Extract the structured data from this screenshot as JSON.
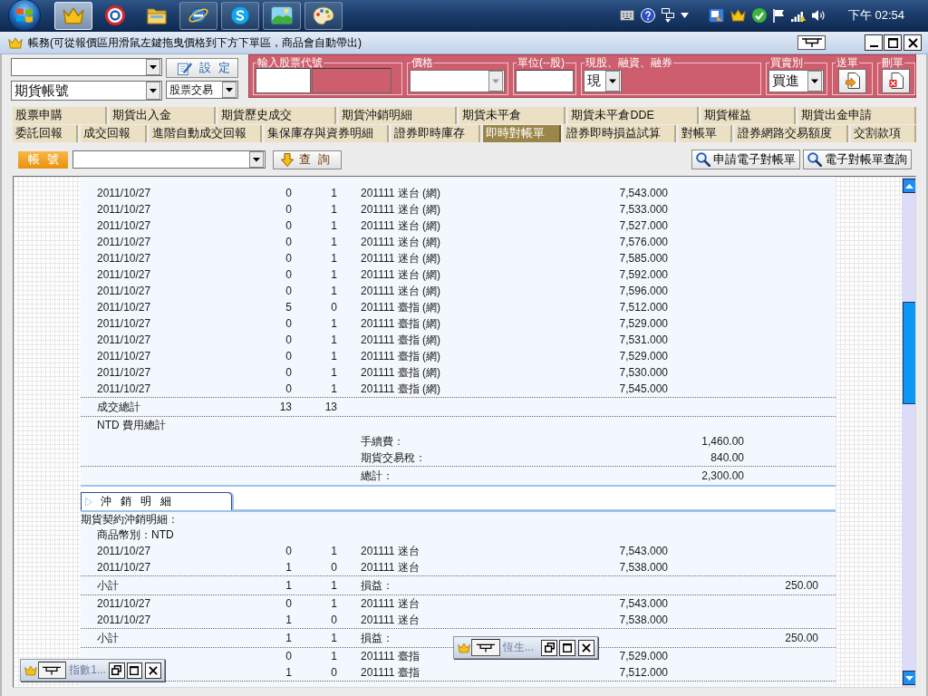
{
  "taskbar": {
    "buttons": [
      {
        "running": true,
        "selected": true
      },
      {
        "running": false,
        "selected": false
      },
      {
        "running": false,
        "selected": false
      },
      {
        "running": true,
        "selected": false
      },
      {
        "running": true,
        "selected": false
      },
      {
        "running": true,
        "selected": false
      },
      {
        "running": true,
        "selected": false
      }
    ],
    "clock": "下午 02:54"
  },
  "window": {
    "title": "帳務(可從報價區用滑鼠左鍵拖曳價格到下方下單區，商品會自動帶出)"
  },
  "order_form": {
    "settings_button": "設定",
    "account_select": {
      "value": "期貨帳號"
    },
    "trade_type_select": {
      "value": "股票交易"
    }
  },
  "order_panel": {
    "stock_code": {
      "label": "輸入股票代號"
    },
    "price": {
      "label": "價格",
      "disabled": true
    },
    "unit": {
      "label": "單位(--股)"
    },
    "position_type": {
      "label": "現股、融資、融券",
      "value": "現"
    },
    "side": {
      "label": "買賣別",
      "value": "買進"
    },
    "send": {
      "label": "送單"
    },
    "delete": {
      "label": "刪單"
    }
  },
  "tab_rows": [
    [
      {
        "label": "股票申購",
        "selected": false
      },
      {
        "label": "期貨出入金",
        "selected": false
      },
      {
        "label": "期貨歷史成交",
        "selected": false
      },
      {
        "label": "期貨沖銷明細",
        "selected": false
      },
      {
        "label": "期貨未平倉",
        "selected": false
      },
      {
        "label": "期貨未平倉DDE",
        "selected": false
      },
      {
        "label": "期貨權益",
        "selected": false
      },
      {
        "label": "期貨出金申請",
        "selected": false
      }
    ],
    [
      {
        "label": "委託回報",
        "selected": false
      },
      {
        "label": "成交回報",
        "selected": false
      },
      {
        "label": "進階自動成交回報",
        "selected": false
      },
      {
        "label": "集保庫存與資券明細",
        "selected": false
      },
      {
        "label": "證券即時庫存",
        "selected": false
      },
      {
        "label": "即時對帳單",
        "selected": true
      },
      {
        "label": "證券即時損益試算",
        "selected": false
      },
      {
        "label": "對帳單",
        "selected": false
      },
      {
        "label": "證券網路交易額度",
        "selected": false
      },
      {
        "label": "交割款項",
        "selected": false
      }
    ]
  ],
  "toolbar": {
    "account_label": "帳號",
    "query_button": "查詢",
    "actions": [
      "申請電子對帳單",
      "電子對帳單查詢"
    ]
  },
  "statement": {
    "trades": [
      {
        "date": "2011/10/27",
        "column_2": "0",
        "column_3": "1",
        "contract": "201111 迷台 (網)",
        "price": "7,543.000"
      },
      {
        "date": "2011/10/27",
        "column_2": "0",
        "column_3": "1",
        "contract": "201111 迷台 (網)",
        "price": "7,533.000"
      },
      {
        "date": "2011/10/27",
        "column_2": "0",
        "column_3": "1",
        "contract": "201111 迷台 (網)",
        "price": "7,527.000"
      },
      {
        "date": "2011/10/27",
        "column_2": "0",
        "column_3": "1",
        "contract": "201111 迷台 (網)",
        "price": "7,576.000"
      },
      {
        "date": "2011/10/27",
        "column_2": "0",
        "column_3": "1",
        "contract": "201111 迷台 (網)",
        "price": "7,585.000"
      },
      {
        "date": "2011/10/27",
        "column_2": "0",
        "column_3": "1",
        "contract": "201111 迷台 (網)",
        "price": "7,592.000"
      },
      {
        "date": "2011/10/27",
        "column_2": "0",
        "column_3": "1",
        "contract": "201111 迷台 (網)",
        "price": "7,596.000"
      },
      {
        "date": "2011/10/27",
        "column_2": "5",
        "column_3": "0",
        "contract": "201111 臺指 (網)",
        "price": "7,512.000"
      },
      {
        "date": "2011/10/27",
        "column_2": "0",
        "column_3": "1",
        "contract": "201111 臺指 (網)",
        "price": "7,529.000"
      },
      {
        "date": "2011/10/27",
        "column_2": "0",
        "column_3": "1",
        "contract": "201111 臺指 (網)",
        "price": "7,531.000"
      },
      {
        "date": "2011/10/27",
        "column_2": "0",
        "column_3": "1",
        "contract": "201111 臺指 (網)",
        "price": "7,529.000"
      },
      {
        "date": "2011/10/27",
        "column_2": "0",
        "column_3": "1",
        "contract": "201111 臺指 (網)",
        "price": "7,530.000"
      },
      {
        "date": "2011/10/27",
        "column_2": "0",
        "column_3": "1",
        "contract": "201111 臺指 (網)",
        "price": "7,545.000"
      }
    ],
    "trade_total": {
      "label": "成交總計",
      "column_2": "13",
      "column_3": "13"
    },
    "fee_summary": {
      "title": "NTD 費用總計",
      "items": [
        {
          "label": "手續費：",
          "amount": "1,460.00"
        },
        {
          "label": "期貨交易稅：",
          "amount": "840.00"
        }
      ],
      "total": {
        "label": "總計：",
        "amount": "2,300.00"
      }
    },
    "offset": {
      "tab": "沖銷明細",
      "heading": "期貨契約沖銷明細：",
      "currency": "商品幣別：NTD",
      "groups": [
        {
          "rows": [
            {
              "date": "2011/10/27",
              "column_2": "0",
              "column_3": "1",
              "contract": "201111 迷台",
              "price": "7,543.000"
            },
            {
              "date": "2011/10/27",
              "column_2": "1",
              "column_3": "0",
              "contract": "201111 迷台",
              "price": "7,538.000"
            }
          ],
          "subtotal": {
            "label": "小計",
            "column_2": "1",
            "column_3": "1",
            "pnl_label": "損益：",
            "pnl": "250.00"
          }
        },
        {
          "rows": [
            {
              "date": "2011/10/27",
              "column_2": "0",
              "column_3": "1",
              "contract": "201111 迷台",
              "price": "7,543.000"
            },
            {
              "date": "2011/10/27",
              "column_2": "1",
              "column_3": "0",
              "contract": "201111 迷台",
              "price": "7,538.000"
            }
          ],
          "subtotal": {
            "label": "小計",
            "column_2": "1",
            "column_3": "1",
            "pnl_label": "損益：",
            "pnl": "250.00"
          }
        },
        {
          "rows": [
            {
              "column_2": "0",
              "column_3": "1",
              "contract": "201111 臺指",
              "price": "7,529.000"
            },
            {
              "column_2": "1",
              "column_3": "0",
              "contract": "201111 臺指",
              "price": "7,512.000"
            }
          ]
        }
      ]
    }
  },
  "mini_windows": [
    {
      "title": "指數1..."
    },
    {
      "title": "恆生..."
    }
  ]
}
